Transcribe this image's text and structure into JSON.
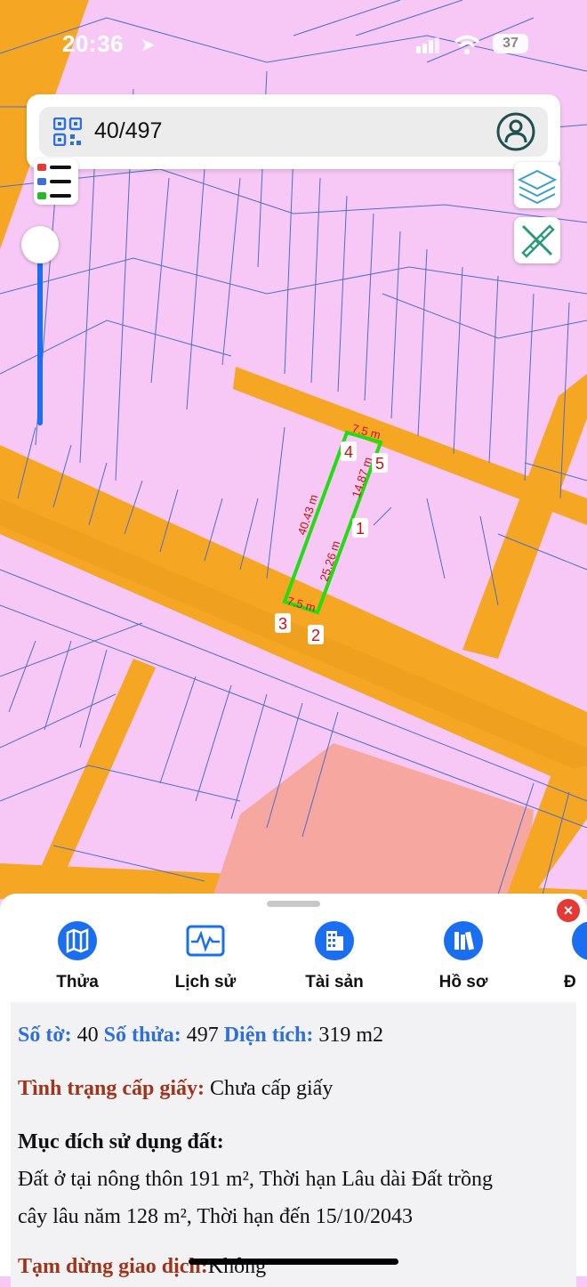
{
  "status_bar": {
    "time": "20:36",
    "battery": "37"
  },
  "search": {
    "value": "40/497"
  },
  "map": {
    "colors": {
      "residential": "#f7c8f5",
      "road": "#f5a623",
      "plot_line": "#4d6ec9",
      "highlight": "#22dd11",
      "salmon": "#f6a7a0"
    },
    "edge_labels": [
      "7.5 m",
      "14.87 m",
      "25.26 m",
      "40.43 m",
      "7.5 m"
    ],
    "vertex_labels": [
      "1",
      "2",
      "3",
      "4",
      "5"
    ]
  },
  "tabs": [
    {
      "label": "Thửa",
      "icon": "map-icon"
    },
    {
      "label": "Lịch sử",
      "icon": "history-icon"
    },
    {
      "label": "Tài sản",
      "icon": "building-icon"
    },
    {
      "label": "Hồ sơ",
      "icon": "books-icon"
    },
    {
      "label": "Đ",
      "icon": "more-icon"
    }
  ],
  "info": {
    "so_to_label": "Số tờ:",
    "so_to": "40",
    "so_thua_label": "Số thửa:",
    "so_thua": "497",
    "dien_tich_label": "Diện tích:",
    "dien_tich": "319 m2",
    "tinh_trang_label": "Tình trạng cấp giấy:",
    "tinh_trang": "Chưa cấp giấy",
    "muc_dich_label": "Mục đích sử dụng đất:",
    "muc_dich_line1": "Đất ở tại nông thôn 191 m², Thời hạn Lâu dài Đất trồng",
    "muc_dich_line2": "cây lâu năm 128 m², Thời hạn đến 15/10/2043",
    "tam_dung_label": "Tạm dừng giao dịch:",
    "tam_dung": "Không"
  }
}
